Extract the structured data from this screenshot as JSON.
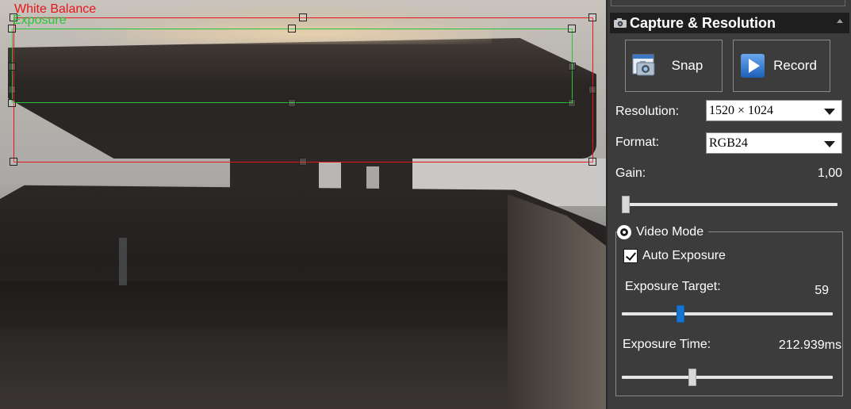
{
  "preview": {
    "roi_white_balance_label": "White Balance",
    "roi_exposure_label": "Exposure",
    "roi_white_balance_color": "#e8151b",
    "roi_exposure_color": "#27c63a"
  },
  "panel": {
    "section_title": "Capture & Resolution",
    "section_icon": "camera-icon",
    "snap_label": "Snap",
    "snap_icon": "snap-photo-icon",
    "record_label": "Record",
    "record_icon": "play-icon",
    "resolution_label": "Resolution:",
    "resolution_value": "1520 × 1024",
    "format_label": "Format:",
    "format_value": "RGB24",
    "gain_label": "Gain:",
    "gain_value": "1,00",
    "gain_level_fraction": 0.0,
    "video_mode_label": "Video Mode",
    "video_mode_selected": true,
    "auto_exposure_label": "Auto Exposure",
    "auto_exposure_checked": true,
    "exposure_target_label": "Exposure Target:",
    "exposure_target_value": "59",
    "exposure_target_fraction": 0.27,
    "exposure_time_label": "Exposure Time:",
    "exposure_time_value": "212.939ms",
    "exposure_time_fraction": 0.33,
    "accent_color": "#1475d2"
  }
}
